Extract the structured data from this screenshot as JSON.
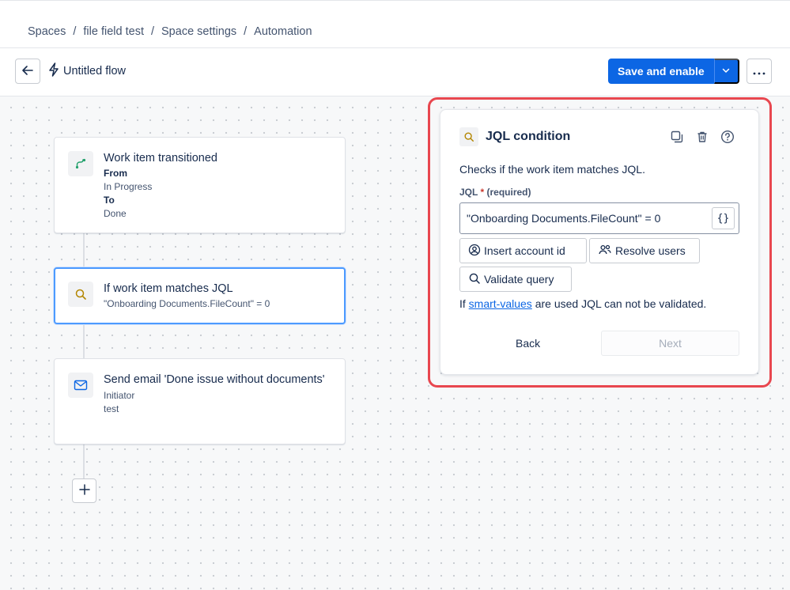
{
  "breadcrumb": [
    {
      "label": "Spaces"
    },
    {
      "label": "file field test"
    },
    {
      "label": "Space settings"
    },
    {
      "label": "Automation"
    }
  ],
  "breadcrumb_separator": "/",
  "toolbar": {
    "flow_title": "Untitled flow",
    "save_label": "Save and enable"
  },
  "flow": {
    "trigger": {
      "title": "Work item transitioned",
      "from_label": "From",
      "from_value": "In Progress",
      "to_label": "To",
      "to_value": "Done"
    },
    "condition": {
      "title": "If work item matches JQL",
      "query": "\"Onboarding Documents.FileCount\" = 0"
    },
    "action": {
      "title": "Send email 'Done issue without documents'",
      "line1": "Initiator",
      "line2": "test"
    }
  },
  "panel": {
    "title": "JQL condition",
    "description": "Checks if the work item matches JQL.",
    "field_label": "JQL",
    "required_mark": "*",
    "required_text": "(required)",
    "jql_value": "\"Onboarding Documents.FileCount\" = 0",
    "braces_label": "{}",
    "insert_account_label": "Insert account id",
    "resolve_users_label": "Resolve users",
    "validate_label": "Validate query",
    "hint_prefix": "If ",
    "hint_link": "smart-values",
    "hint_suffix": " are used JQL can not be validated.",
    "back_label": "Back",
    "next_label": "Next"
  },
  "colors": {
    "primary": "#0c66e4",
    "highlight": "#e8474f",
    "selected_border": "#4c9aff",
    "trigger_icon": "#22a06b",
    "condition_icon": "#b38600",
    "action_icon": "#0c66e4"
  },
  "icons": {
    "back": "arrow-left-icon",
    "flow": "lightning-icon",
    "dropdown": "chevron-down-icon",
    "more": "more-horizontal-icon",
    "trigger": "route-icon",
    "condition": "search-icon",
    "action": "email-icon",
    "duplicate": "duplicate-icon",
    "delete": "trash-icon",
    "help": "question-circle-icon",
    "account": "person-circle-icon",
    "users": "people-icon",
    "add": "plus-icon"
  }
}
